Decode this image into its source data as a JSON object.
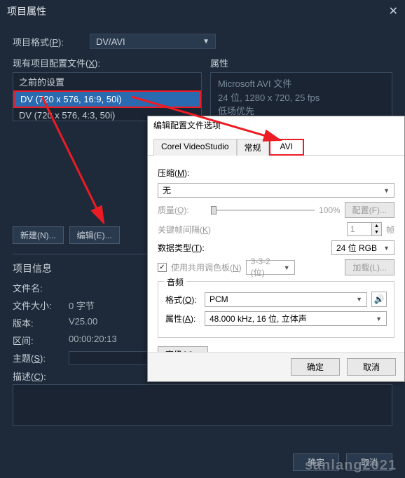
{
  "dialog": {
    "title": "项目属性",
    "format_label": "项目格式(",
    "format_key": "P",
    "format_suffix": "):",
    "format_value": "DV/AVI",
    "existing_label": "现有项目配置文件(",
    "existing_key": "X",
    "existing_suffix": "):",
    "config_items": [
      "之前的设置",
      "DV (720 x 576, 16:9, 50i)",
      "DV (720 x 576, 4:3, 50i)"
    ],
    "attr_label": "属性",
    "attrs": [
      "Microsoft AVI 文件",
      "24 位, 1280 x 720, 25 fps",
      "低场优先"
    ],
    "new_btn": "新建(N)...",
    "edit_btn": "编辑(E)...",
    "info_title": "项目信息",
    "filename_label": "文件名:",
    "filesize_label": "文件大小:",
    "filesize_value": "0 字节",
    "version_label": "版本:",
    "version_value": "V25.00",
    "range_label": "区间:",
    "range_value": "00:00:20:13",
    "subject_label": "主题(",
    "subject_key": "S",
    "subject_suffix": "):",
    "desc_label": "描述(",
    "desc_key": "C",
    "desc_suffix": "):",
    "ok_btn": "确定",
    "cancel_btn": "取消"
  },
  "light": {
    "title": "编辑配置文件选项",
    "tabs": [
      "Corel VideoStudio",
      "常规",
      "AVI"
    ],
    "compress_label": "压缩(",
    "compress_key": "M",
    "compress_suffix": "):",
    "compress_value": "无",
    "quality_label": "质量(",
    "quality_key": "Q",
    "quality_suffix": "):",
    "quality_value": "100%",
    "config_btn": "配置(F)...",
    "keyframe_label": "关键帧间隔(",
    "keyframe_key": "K",
    "keyframe_suffix": ")",
    "keyframe_value": "1",
    "keyframe_unit": "帧",
    "datatype_label": "数据类型(",
    "datatype_key": "T",
    "datatype_suffix": "):",
    "datatype_value": "24 位 RGB",
    "palette_cb": "使用共用调色板(",
    "palette_key": "N",
    "palette_suffix": ")",
    "palette_value": "3-3-2 (位)",
    "load_btn": "加载(L)...",
    "audio_group": "音频",
    "audio_format_label": "格式(",
    "audio_format_key": "O",
    "audio_format_suffix": "):",
    "audio_format_value": "PCM",
    "audio_attr_label": "属性(",
    "audio_attr_key": "A",
    "audio_attr_suffix": "):",
    "audio_attr_value": "48.000 kHz, 16 位, 立体声",
    "advanced_btn": "高级(V)...",
    "ok": "确定",
    "cancel": "取消"
  },
  "watermark": "sanlang2021"
}
